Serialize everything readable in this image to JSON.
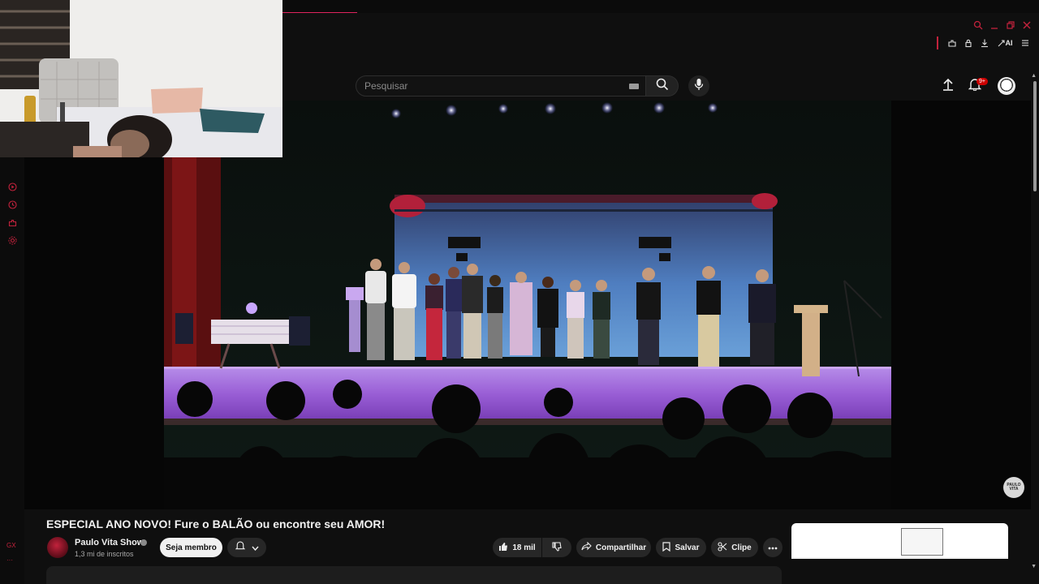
{
  "browser": {
    "sidebar_labels": {
      "gx": "GX",
      "more": "···"
    },
    "ext_ai_label": "AI",
    "close_x": "✕"
  },
  "search": {
    "placeholder": "Pesquisar"
  },
  "header": {
    "notification_badge": "9+"
  },
  "player": {
    "watermark_text": "PAULO VITA"
  },
  "video": {
    "title": "ESPECIAL ANO NOVO! Fure o BALÃO ou encontre seu AMOR!",
    "channel_name": "Paulo Vita Show",
    "subscribers": "1,3 mi de inscritos",
    "member_label": "Seja membro",
    "like_count": "18 mil",
    "share_label": "Compartilhar",
    "save_label": "Salvar",
    "clip_label": "Clipe"
  },
  "colors": {
    "accent": "#c2223c",
    "youtube_red": "#cc0000",
    "bg": "#0f0f0f",
    "stage_purple": "#9a5fd6"
  },
  "icons": [
    "search-icon",
    "mic-icon",
    "upload-icon",
    "bell-icon",
    "like-icon",
    "dislike-icon",
    "share-icon",
    "save-icon",
    "scissors-icon",
    "more-icon"
  ]
}
